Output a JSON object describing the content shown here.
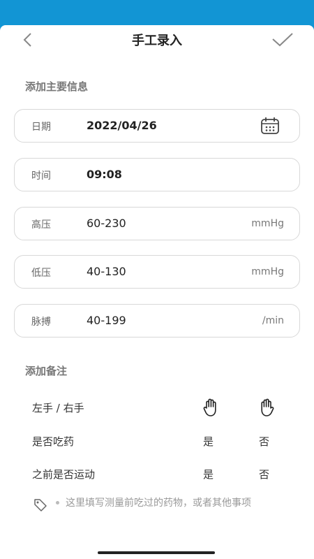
{
  "header": {
    "title": "手工录入"
  },
  "sections": {
    "main_info": "添加主要信息",
    "notes": "添加备注"
  },
  "fields": {
    "date": {
      "label": "日期",
      "value": "2022/04/26"
    },
    "time": {
      "label": "时间",
      "value": "09:08"
    },
    "high": {
      "label": "高压",
      "value": "60-230",
      "unit": "mmHg"
    },
    "low": {
      "label": "低压",
      "value": "40-130",
      "unit": "mmHg"
    },
    "pulse": {
      "label": "脉搏",
      "value": "40-199",
      "unit": "/min"
    }
  },
  "notes": {
    "hand": {
      "label": "左手 / 右手"
    },
    "medicine": {
      "label": "是否吃药",
      "yes": "是",
      "no": "否"
    },
    "exercise": {
      "label": "之前是否运动",
      "yes": "是",
      "no": "否"
    },
    "hint": "这里填写测量前吃过的药物，或者其他事项"
  },
  "colors": {
    "accent": "#1295d4",
    "border": "#d8d8d8"
  },
  "icons": [
    "back-arrow-icon",
    "checkmark-icon",
    "calendar-icon",
    "left-hand-icon",
    "right-hand-icon",
    "tag-icon"
  ]
}
